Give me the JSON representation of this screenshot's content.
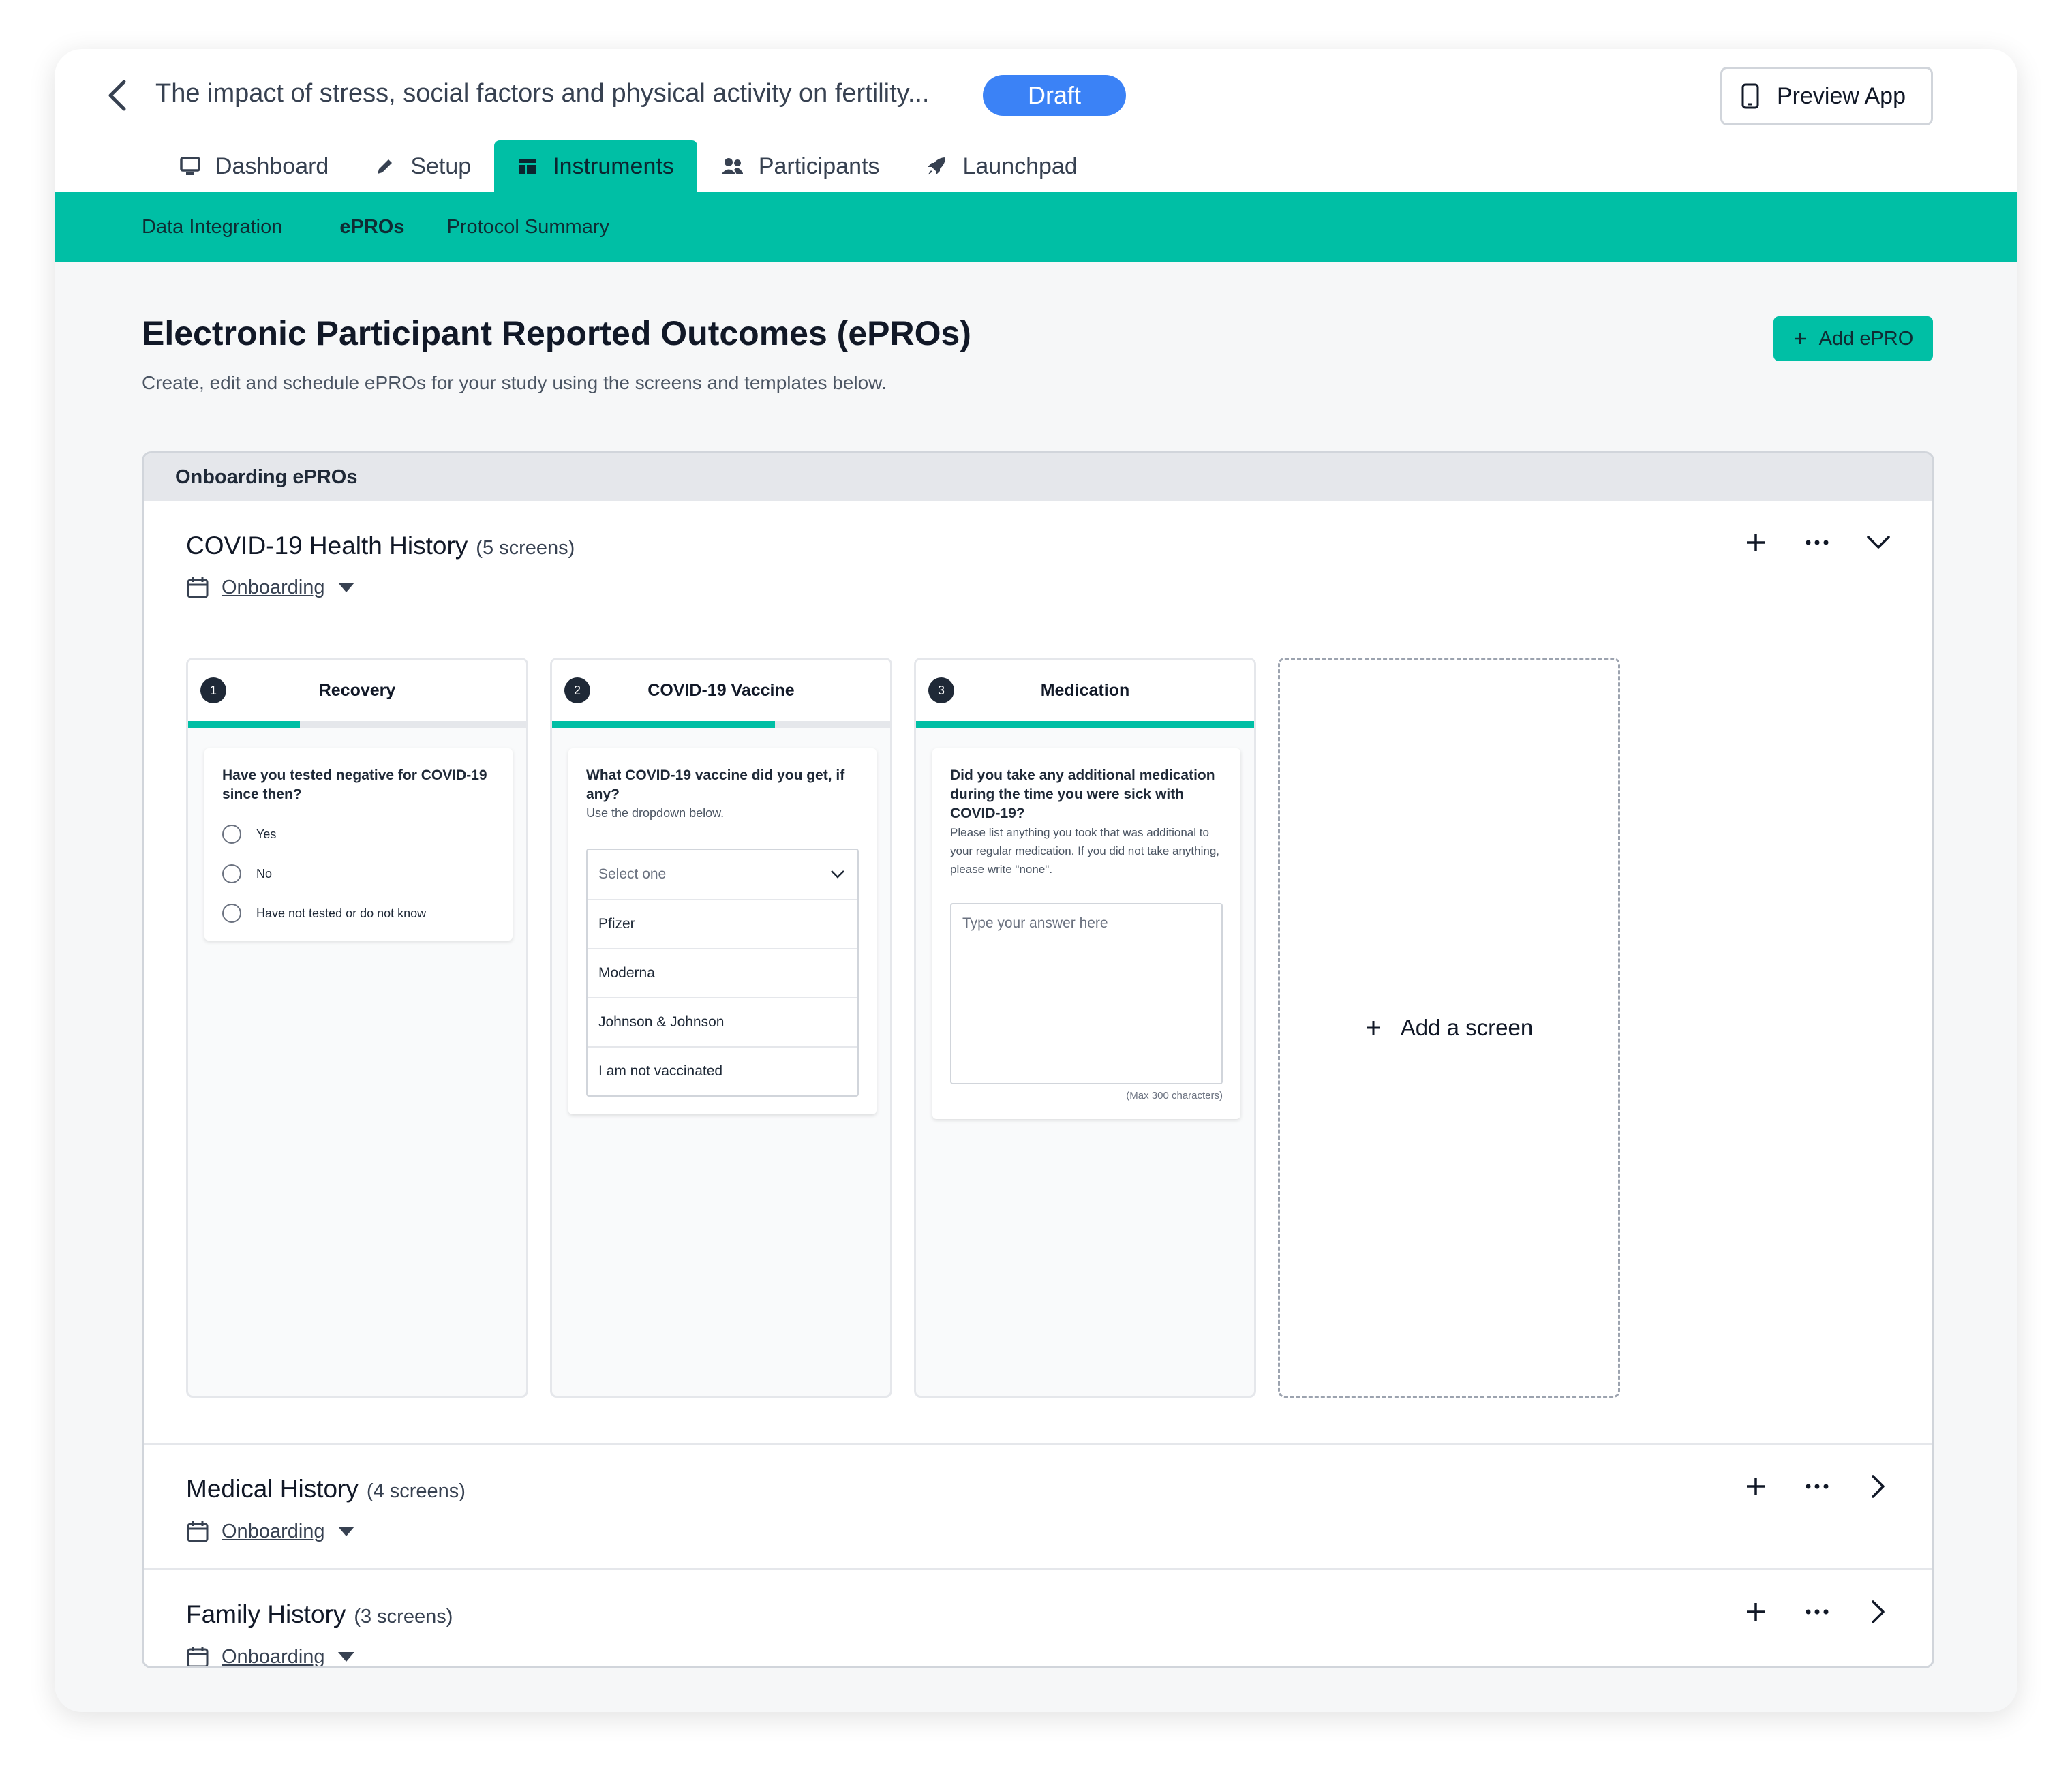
{
  "header": {
    "study_title": "The impact of stress, social factors and physical activity on fertility...",
    "status": "Draft",
    "preview_label": "Preview App"
  },
  "tabs": [
    {
      "label": "Dashboard",
      "icon": "monitor-icon",
      "active": false
    },
    {
      "label": "Setup",
      "icon": "pencil-icon",
      "active": false
    },
    {
      "label": "Instruments",
      "icon": "table-icon",
      "active": true
    },
    {
      "label": "Participants",
      "icon": "users-icon",
      "active": false
    },
    {
      "label": "Launchpad",
      "icon": "rocket-icon",
      "active": false
    }
  ],
  "subnav": [
    "Data Integration",
    "ePROs",
    "Protocol Summary"
  ],
  "page": {
    "title": "Electronic Participant Reported Outcomes (ePROs)",
    "subtitle": "Create, edit and schedule ePROs for your study using the screens and templates below.",
    "add_button": "Add ePRO"
  },
  "panel": {
    "title": "Onboarding ePROs",
    "groups": [
      {
        "title": "COVID-19 Health History",
        "count": "(5 screens)",
        "schedule": "Onboarding",
        "expanded": true,
        "screens": [
          {
            "number": "1",
            "title": "Recovery",
            "progress": 0.33,
            "question": "Have you tested negative for COVID-19 since then?",
            "options": [
              "Yes",
              "No",
              "Have not tested or do not know"
            ]
          },
          {
            "number": "2",
            "title": "COVID-19 Vaccine",
            "progress": 0.66,
            "question": "What COVID-19 vaccine did you get, if any?",
            "hint": "Use the dropdown below.",
            "placeholder": "Select one",
            "options": [
              "Pfizer",
              "Moderna",
              "Johnson & Johnson",
              "I am not vaccinated"
            ]
          },
          {
            "number": "3",
            "title": "Medication",
            "progress": 1.0,
            "question": "Did you take any additional medication during the time you were sick with COVID-19?",
            "hint": "Please list anything you took that was additional to your regular medication. If you did not take anything, please write \"none\".",
            "placeholder": "Type your answer here",
            "max_note": "(Max 300 characters)"
          }
        ],
        "add_screen_label": "Add a screen"
      },
      {
        "title": "Medical History",
        "count": "(4 screens)",
        "schedule": "Onboarding",
        "expanded": false
      },
      {
        "title": "Family History",
        "count": "(3 screens)",
        "schedule": "Onboarding",
        "expanded": false
      }
    ]
  },
  "colors": {
    "accent": "#00bfa5",
    "draft": "#3b82f6"
  }
}
